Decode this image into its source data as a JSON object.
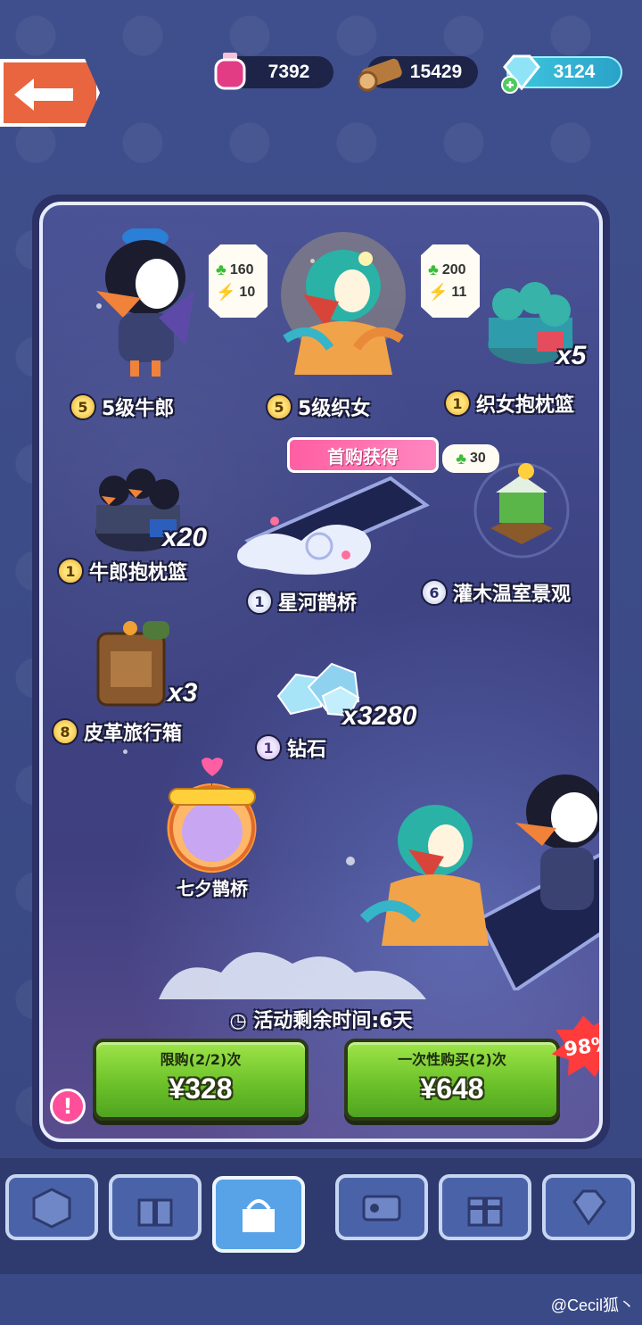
{
  "resources": {
    "ink": "7392",
    "wood": "15429",
    "gems": "3124"
  },
  "items": [
    {
      "level": "5",
      "name": "5级牛郎"
    },
    {
      "level": "5",
      "name": "5级织女"
    },
    {
      "level": "1",
      "name": "织女抱枕篮",
      "qty": "x5"
    },
    {
      "level": "1",
      "name": "牛郎抱枕篮",
      "qty": "x20"
    },
    {
      "level": "1",
      "name": "星河鹊桥"
    },
    {
      "level": "6",
      "name": "灌木温室景观"
    },
    {
      "level": "8",
      "name": "皮革旅行箱",
      "qty": "x3"
    },
    {
      "level": "1",
      "name": "钻石",
      "qty": "x3280"
    },
    {
      "name": "七夕鹊桥"
    }
  ],
  "stats": {
    "niulang": {
      "clover": "160",
      "power": "10"
    },
    "zhinv": {
      "clover": "200",
      "power": "11"
    }
  },
  "first_buy": {
    "label": "首购获得",
    "points": "30"
  },
  "timer": "活动剩余时间:6天",
  "buttons": {
    "left": {
      "limit": "限购(2/2)次",
      "price": "¥328"
    },
    "right": {
      "limit": "一次性购买(2)次",
      "price": "¥648"
    }
  },
  "discount": "98%",
  "info_symbol": "!",
  "watermark": "@Cecil狐丶",
  "colors": {
    "accent_green": "#6dc22a",
    "discount_red": "#ff3b3b",
    "pink": "#ff5fa2"
  }
}
